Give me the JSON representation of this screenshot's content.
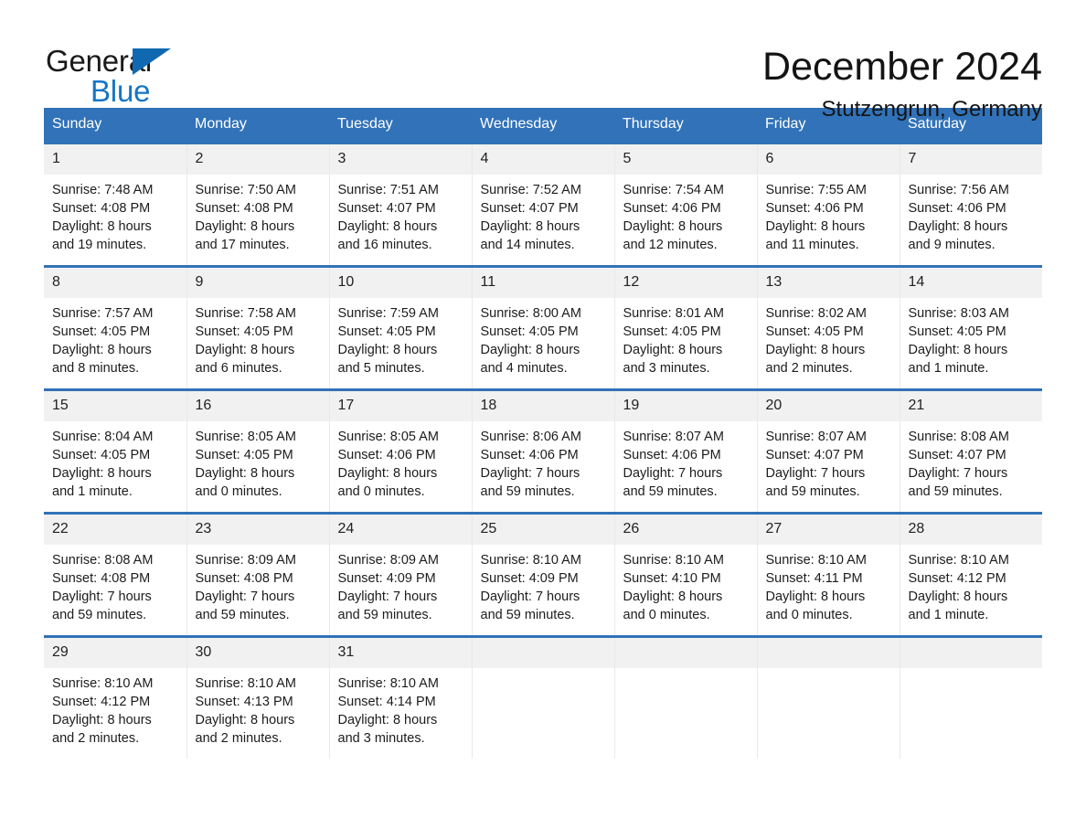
{
  "brand": {
    "word_general": "General",
    "word_blue": "Blue",
    "logo_icon": "triangle-flag-icon",
    "accent_color": "#1575c4"
  },
  "header": {
    "title": "December 2024",
    "location": "Stutzengrun, Germany"
  },
  "theme": {
    "header_blue": "#3172b8",
    "daynum_background": "#f1f1f1",
    "text_color": "#1c1c1c"
  },
  "calendar": {
    "weekday_headers": [
      "Sunday",
      "Monday",
      "Tuesday",
      "Wednesday",
      "Thursday",
      "Friday",
      "Saturday"
    ],
    "weeks": [
      [
        {
          "day": "1",
          "sunrise": "Sunrise: 7:48 AM",
          "sunset": "Sunset: 4:08 PM",
          "daylight_1": "Daylight: 8 hours",
          "daylight_2": "and 19 minutes."
        },
        {
          "day": "2",
          "sunrise": "Sunrise: 7:50 AM",
          "sunset": "Sunset: 4:08 PM",
          "daylight_1": "Daylight: 8 hours",
          "daylight_2": "and 17 minutes."
        },
        {
          "day": "3",
          "sunrise": "Sunrise: 7:51 AM",
          "sunset": "Sunset: 4:07 PM",
          "daylight_1": "Daylight: 8 hours",
          "daylight_2": "and 16 minutes."
        },
        {
          "day": "4",
          "sunrise": "Sunrise: 7:52 AM",
          "sunset": "Sunset: 4:07 PM",
          "daylight_1": "Daylight: 8 hours",
          "daylight_2": "and 14 minutes."
        },
        {
          "day": "5",
          "sunrise": "Sunrise: 7:54 AM",
          "sunset": "Sunset: 4:06 PM",
          "daylight_1": "Daylight: 8 hours",
          "daylight_2": "and 12 minutes."
        },
        {
          "day": "6",
          "sunrise": "Sunrise: 7:55 AM",
          "sunset": "Sunset: 4:06 PM",
          "daylight_1": "Daylight: 8 hours",
          "daylight_2": "and 11 minutes."
        },
        {
          "day": "7",
          "sunrise": "Sunrise: 7:56 AM",
          "sunset": "Sunset: 4:06 PM",
          "daylight_1": "Daylight: 8 hours",
          "daylight_2": "and 9 minutes."
        }
      ],
      [
        {
          "day": "8",
          "sunrise": "Sunrise: 7:57 AM",
          "sunset": "Sunset: 4:05 PM",
          "daylight_1": "Daylight: 8 hours",
          "daylight_2": "and 8 minutes."
        },
        {
          "day": "9",
          "sunrise": "Sunrise: 7:58 AM",
          "sunset": "Sunset: 4:05 PM",
          "daylight_1": "Daylight: 8 hours",
          "daylight_2": "and 6 minutes."
        },
        {
          "day": "10",
          "sunrise": "Sunrise: 7:59 AM",
          "sunset": "Sunset: 4:05 PM",
          "daylight_1": "Daylight: 8 hours",
          "daylight_2": "and 5 minutes."
        },
        {
          "day": "11",
          "sunrise": "Sunrise: 8:00 AM",
          "sunset": "Sunset: 4:05 PM",
          "daylight_1": "Daylight: 8 hours",
          "daylight_2": "and 4 minutes."
        },
        {
          "day": "12",
          "sunrise": "Sunrise: 8:01 AM",
          "sunset": "Sunset: 4:05 PM",
          "daylight_1": "Daylight: 8 hours",
          "daylight_2": "and 3 minutes."
        },
        {
          "day": "13",
          "sunrise": "Sunrise: 8:02 AM",
          "sunset": "Sunset: 4:05 PM",
          "daylight_1": "Daylight: 8 hours",
          "daylight_2": "and 2 minutes."
        },
        {
          "day": "14",
          "sunrise": "Sunrise: 8:03 AM",
          "sunset": "Sunset: 4:05 PM",
          "daylight_1": "Daylight: 8 hours",
          "daylight_2": "and 1 minute."
        }
      ],
      [
        {
          "day": "15",
          "sunrise": "Sunrise: 8:04 AM",
          "sunset": "Sunset: 4:05 PM",
          "daylight_1": "Daylight: 8 hours",
          "daylight_2": "and 1 minute."
        },
        {
          "day": "16",
          "sunrise": "Sunrise: 8:05 AM",
          "sunset": "Sunset: 4:05 PM",
          "daylight_1": "Daylight: 8 hours",
          "daylight_2": "and 0 minutes."
        },
        {
          "day": "17",
          "sunrise": "Sunrise: 8:05 AM",
          "sunset": "Sunset: 4:06 PM",
          "daylight_1": "Daylight: 8 hours",
          "daylight_2": "and 0 minutes."
        },
        {
          "day": "18",
          "sunrise": "Sunrise: 8:06 AM",
          "sunset": "Sunset: 4:06 PM",
          "daylight_1": "Daylight: 7 hours",
          "daylight_2": "and 59 minutes."
        },
        {
          "day": "19",
          "sunrise": "Sunrise: 8:07 AM",
          "sunset": "Sunset: 4:06 PM",
          "daylight_1": "Daylight: 7 hours",
          "daylight_2": "and 59 minutes."
        },
        {
          "day": "20",
          "sunrise": "Sunrise: 8:07 AM",
          "sunset": "Sunset: 4:07 PM",
          "daylight_1": "Daylight: 7 hours",
          "daylight_2": "and 59 minutes."
        },
        {
          "day": "21",
          "sunrise": "Sunrise: 8:08 AM",
          "sunset": "Sunset: 4:07 PM",
          "daylight_1": "Daylight: 7 hours",
          "daylight_2": "and 59 minutes."
        }
      ],
      [
        {
          "day": "22",
          "sunrise": "Sunrise: 8:08 AM",
          "sunset": "Sunset: 4:08 PM",
          "daylight_1": "Daylight: 7 hours",
          "daylight_2": "and 59 minutes."
        },
        {
          "day": "23",
          "sunrise": "Sunrise: 8:09 AM",
          "sunset": "Sunset: 4:08 PM",
          "daylight_1": "Daylight: 7 hours",
          "daylight_2": "and 59 minutes."
        },
        {
          "day": "24",
          "sunrise": "Sunrise: 8:09 AM",
          "sunset": "Sunset: 4:09 PM",
          "daylight_1": "Daylight: 7 hours",
          "daylight_2": "and 59 minutes."
        },
        {
          "day": "25",
          "sunrise": "Sunrise: 8:10 AM",
          "sunset": "Sunset: 4:09 PM",
          "daylight_1": "Daylight: 7 hours",
          "daylight_2": "and 59 minutes."
        },
        {
          "day": "26",
          "sunrise": "Sunrise: 8:10 AM",
          "sunset": "Sunset: 4:10 PM",
          "daylight_1": "Daylight: 8 hours",
          "daylight_2": "and 0 minutes."
        },
        {
          "day": "27",
          "sunrise": "Sunrise: 8:10 AM",
          "sunset": "Sunset: 4:11 PM",
          "daylight_1": "Daylight: 8 hours",
          "daylight_2": "and 0 minutes."
        },
        {
          "day": "28",
          "sunrise": "Sunrise: 8:10 AM",
          "sunset": "Sunset: 4:12 PM",
          "daylight_1": "Daylight: 8 hours",
          "daylight_2": "and 1 minute."
        }
      ],
      [
        {
          "day": "29",
          "sunrise": "Sunrise: 8:10 AM",
          "sunset": "Sunset: 4:12 PM",
          "daylight_1": "Daylight: 8 hours",
          "daylight_2": "and 2 minutes."
        },
        {
          "day": "30",
          "sunrise": "Sunrise: 8:10 AM",
          "sunset": "Sunset: 4:13 PM",
          "daylight_1": "Daylight: 8 hours",
          "daylight_2": "and 2 minutes."
        },
        {
          "day": "31",
          "sunrise": "Sunrise: 8:10 AM",
          "sunset": "Sunset: 4:14 PM",
          "daylight_1": "Daylight: 8 hours",
          "daylight_2": "and 3 minutes."
        },
        {
          "day": "",
          "sunrise": "",
          "sunset": "",
          "daylight_1": "",
          "daylight_2": ""
        },
        {
          "day": "",
          "sunrise": "",
          "sunset": "",
          "daylight_1": "",
          "daylight_2": ""
        },
        {
          "day": "",
          "sunrise": "",
          "sunset": "",
          "daylight_1": "",
          "daylight_2": ""
        },
        {
          "day": "",
          "sunrise": "",
          "sunset": "",
          "daylight_1": "",
          "daylight_2": ""
        }
      ]
    ]
  }
}
